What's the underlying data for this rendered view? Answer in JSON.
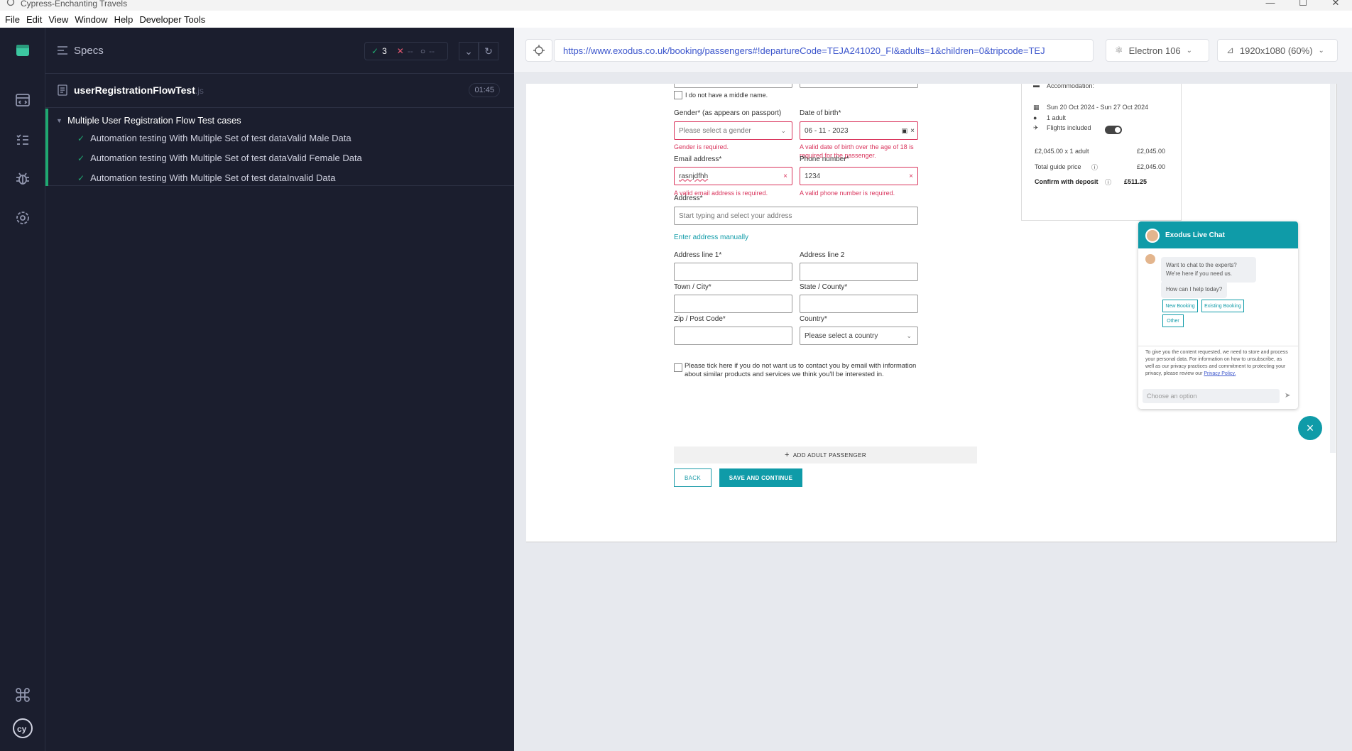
{
  "window": {
    "title": "Cypress-Enchanting Travels",
    "menu": [
      "File",
      "Edit",
      "View",
      "Window",
      "Help",
      "Developer Tools"
    ]
  },
  "specs": {
    "header": "Specs",
    "stats": {
      "passed": "3",
      "failed": "--",
      "pending": "--"
    },
    "file": {
      "name": "userRegistrationFlowTest",
      "ext": ".js",
      "time": "01:45"
    },
    "suite": "Multiple User Registration Flow Test cases",
    "tests": [
      "Automation testing With Multiple Set of test dataValid Male Data",
      "Automation testing With Multiple Set of test dataValid Female Data",
      "Automation testing With Multiple Set of test dataInvalid Data"
    ]
  },
  "browser": {
    "url": "https://www.exodus.co.uk/booking/passengers#!departureCode=TEJA241020_FI&adults=1&children=0&tripcode=TEJ",
    "engine": "Electron 106",
    "viewport": "1920x1080 (60%)"
  },
  "form": {
    "middle_name_check": "I do not have a middle name.",
    "gender_label": "Gender* (as appears on passport)",
    "gender_placeholder": "Please select a gender",
    "gender_error": "Gender is required.",
    "dob_label": "Date of birth*",
    "dob_value": "06 - 11 - 2023",
    "dob_error": "A valid date of birth over the age of 18 is required for the passenger.",
    "email_label": "Email address*",
    "email_value": "rasnjdfhh",
    "email_error": "A valid email address is required.",
    "phone_label": "Phone number*",
    "phone_value": "1234",
    "phone_error": "A valid phone number is required.",
    "address_label": "Address*",
    "address_placeholder": "Start typing and select your address",
    "manual_link": "Enter address manually",
    "line1_label": "Address line 1*",
    "line2_label": "Address line 2",
    "town_label": "Town / City*",
    "state_label": "State / County*",
    "zip_label": "Zip / Post Code*",
    "country_label": "Country*",
    "country_placeholder": "Please select a country",
    "optout_text": "Please tick here if you do not want us to contact you by email with information about similar products and services we think you'll be interested in.",
    "add_passenger": "ADD ADULT PASSENGER",
    "back": "BACK",
    "save": "SAVE AND CONTINUE"
  },
  "summary": {
    "accommodation": "Accommodation:",
    "dates": "Sun 20 Oct 2024 - Sun 27 Oct 2024",
    "adults": "1 adult",
    "flights": "Flights included",
    "price_line": "£2,045.00 x 1 adult",
    "price_line_value": "£2,045.00",
    "total_label": "Total guide price",
    "total_value": "£2,045.00",
    "deposit_label": "Confirm with deposit",
    "deposit_value": "£511.25"
  },
  "chat": {
    "title": "Exodus Live Chat",
    "msg1": "Want to chat to the experts? We're here if you need us.",
    "msg2": "How can I help today?",
    "options": [
      "New Booking",
      "Existing Booking",
      "Other"
    ],
    "footer": "To give you the content requested, we need to store and process your personal data. For information on how to unsubscribe, as well as our privacy practices and commitment to protecting your privacy, please review our",
    "footer_link": "Privacy Policy.",
    "input_placeholder": "Choose an option"
  }
}
